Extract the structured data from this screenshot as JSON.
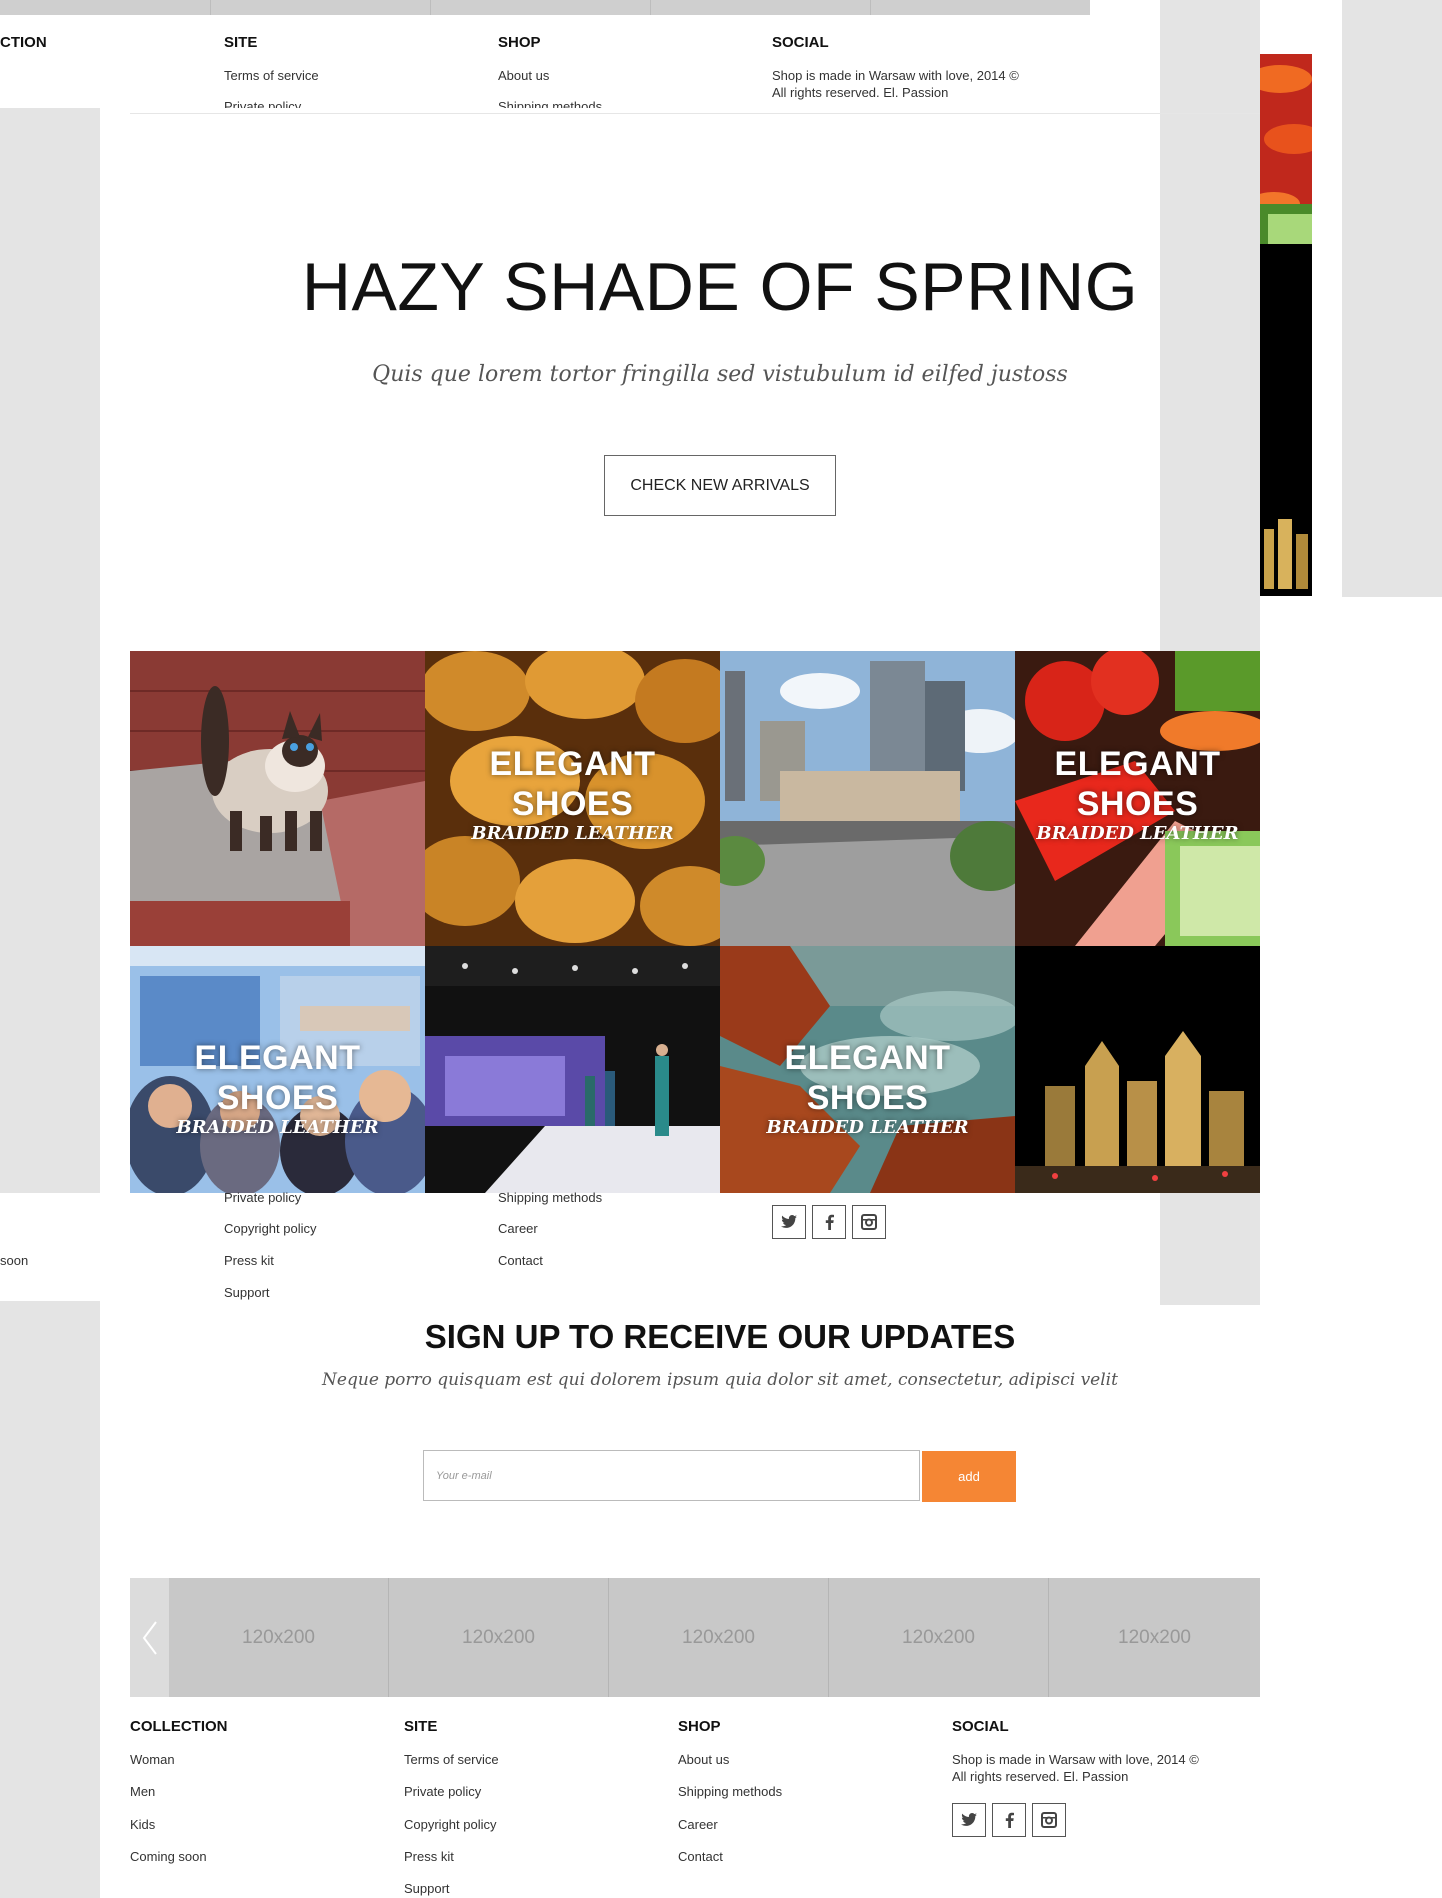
{
  "colors": {
    "accent": "#f58634",
    "page_bg": "#e4e4e4"
  },
  "top_footer": {
    "collection_heading": "CTION",
    "site": {
      "heading": "SITE",
      "links": [
        "Terms of service",
        "Private policy"
      ]
    },
    "shop": {
      "heading": "SHOP",
      "links": [
        "About us",
        "Shipping methods"
      ]
    },
    "social": {
      "heading": "SOCIAL",
      "text1": "Shop is made in Warsaw with love, 2014 ©",
      "text2": "All rights reserved. El. Passion"
    }
  },
  "hero": {
    "title": "HAZY SHADE OF SPRING",
    "subtitle": "Quis que lorem tortor fringilla sed vistubulum id eilfed justoss",
    "button": "CHECK NEW ARRIVALS"
  },
  "grid": {
    "tiles": [
      {
        "image": "cat",
        "title": "",
        "subtitle": ""
      },
      {
        "image": "bread",
        "title": "ELEGANT SHOES",
        "subtitle": "BRAIDED LEATHER"
      },
      {
        "image": "city",
        "title": "",
        "subtitle": ""
      },
      {
        "image": "vegetables",
        "title": "ELEGANT SHOES",
        "subtitle": "BRAIDED LEATHER"
      },
      {
        "image": "train-people",
        "title": "ELEGANT SHOES",
        "subtitle": "BRAIDED LEATHER"
      },
      {
        "image": "fashion-runway",
        "title": "",
        "subtitle": ""
      },
      {
        "image": "rocky-coast",
        "title": "ELEGANT SHOES",
        "subtitle": "BRAIDED LEATHER"
      },
      {
        "image": "night-city",
        "title": "",
        "subtitle": ""
      }
    ]
  },
  "mid_footer": {
    "collection_item": "soon",
    "site_links": [
      "Private policy",
      "Copyright policy",
      "Press kit",
      "Support"
    ],
    "shop_links": [
      "Shipping methods",
      "Career",
      "Contact"
    ]
  },
  "signup": {
    "title": "SIGN UP TO RECEIVE OUR UPDATES",
    "subtitle": "Neque porro quisquam est qui dolorem ipsum quia dolor sit amet, consectetur, adipisci velit",
    "email_placeholder": "Your e-mail",
    "button": "add"
  },
  "carousel": {
    "prev_icon": "chevron-left-icon",
    "items": [
      "120x200",
      "120x200",
      "120x200",
      "120x200",
      "120x200"
    ]
  },
  "footer": {
    "collection": {
      "heading": "COLLECTION",
      "links": [
        "Woman",
        "Men",
        "Kids",
        "Coming soon"
      ]
    },
    "site": {
      "heading": "SITE",
      "links": [
        "Terms of service",
        "Private policy",
        "Copyright policy",
        "Press kit",
        "Support"
      ]
    },
    "shop": {
      "heading": "SHOP",
      "links": [
        "About us",
        "Shipping methods",
        "Career",
        "Contact"
      ]
    },
    "social": {
      "heading": "SOCIAL",
      "text1": "Shop is made in Warsaw with love, 2014 ©",
      "text2": "All rights reserved. El. Passion",
      "icons": [
        "twitter-icon",
        "facebook-icon",
        "instagram-icon"
      ]
    }
  }
}
